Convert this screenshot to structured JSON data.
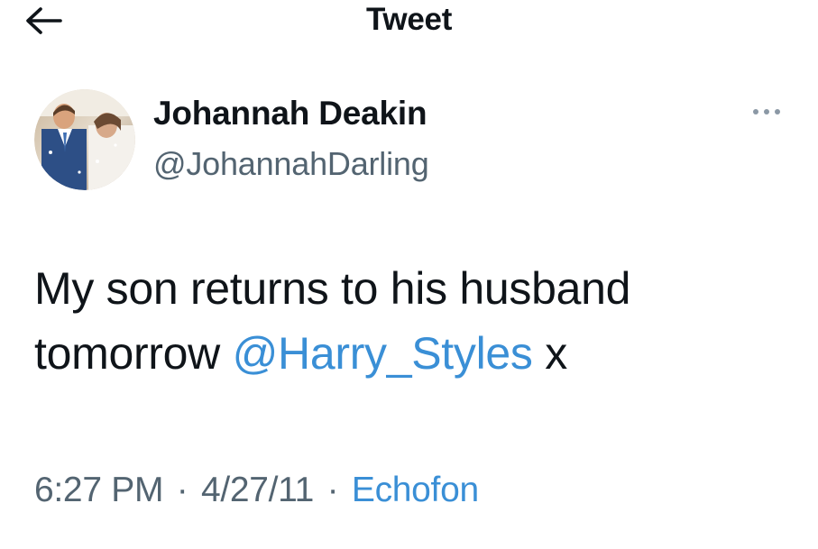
{
  "header": {
    "title": "Tweet",
    "back_icon": "arrow-left-icon"
  },
  "author": {
    "display_name": "Johannah Deakin",
    "handle": "@JohannahDarling",
    "avatar_icon": "profile-photo"
  },
  "more_icon": "more-options-icon",
  "tweet": {
    "text_before": "My son returns to his husband tomorrow ",
    "mention": "@Harry_Styles",
    "text_after": " x"
  },
  "meta": {
    "time": "6:27 PM",
    "separator": "·",
    "date": "4/27/11",
    "source": "Echofon"
  },
  "colors": {
    "link": "#3a8fd6",
    "secondary_text": "#536471",
    "primary_text": "#0f1419"
  }
}
